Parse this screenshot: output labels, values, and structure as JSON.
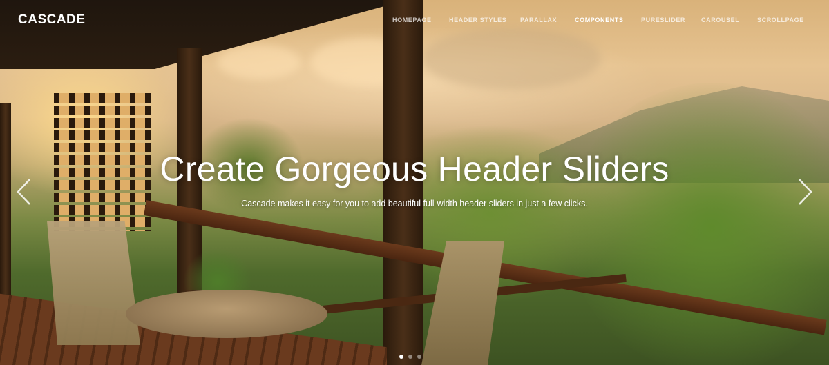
{
  "header": {
    "logo_text": "CASCADE",
    "nav": [
      {
        "label": "HOMEPAGE",
        "active": false
      },
      {
        "label": "HEADER STYLES",
        "active": false
      },
      {
        "label": "PARALLAX",
        "active": false
      },
      {
        "label": "COMPONENTS",
        "active": true
      },
      {
        "label": "PURESLIDER",
        "active": false
      },
      {
        "label": "CAROUSEL",
        "active": false
      },
      {
        "label": "SCROLLPAGE",
        "active": false
      }
    ]
  },
  "slider": {
    "headline": "Create Gorgeous Header Sliders",
    "subtext": "Cascade makes it easy for you to add beautiful full-width header sliders in just a few clicks.",
    "prev_icon": "chevron-left-icon",
    "next_icon": "chevron-right-icon",
    "pagination": {
      "total": 3,
      "active_index": 0
    }
  },
  "colors": {
    "text": "#ffffff",
    "nav_inactive": "rgba(255,255,255,0.72)",
    "dot_inactive": "rgba(255,255,255,0.45)"
  }
}
